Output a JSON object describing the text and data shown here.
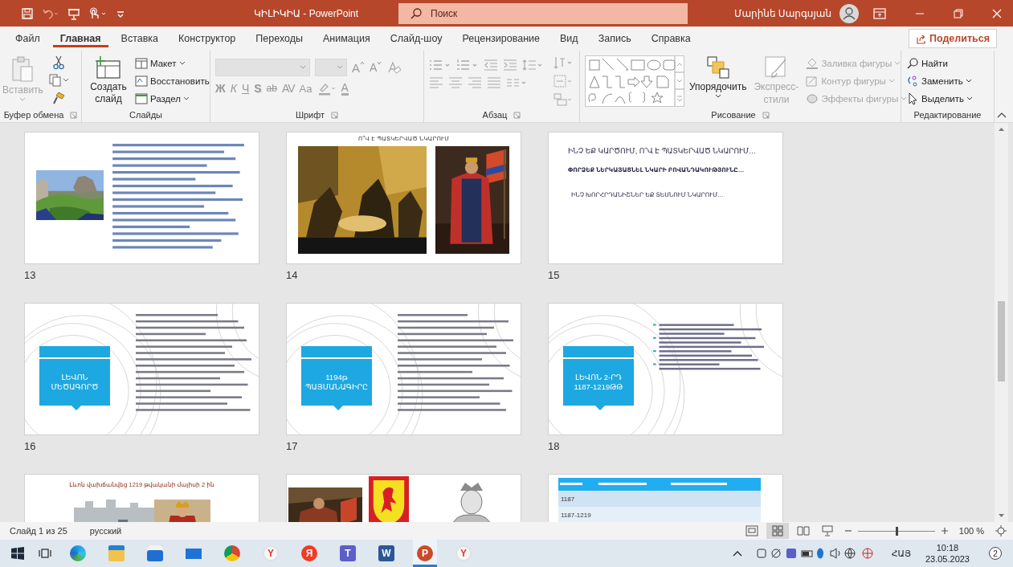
{
  "window": {
    "title": "ԿԻԼԻԿԻԱ  -  PowerPoint",
    "search_placeholder": "Поиск",
    "user": "Մարինե Սարգսյան"
  },
  "menu_tabs": [
    {
      "label": "Файл",
      "selected": false
    },
    {
      "label": "Главная",
      "selected": true
    },
    {
      "label": "Вставка",
      "selected": false
    },
    {
      "label": "Конструктор",
      "selected": false
    },
    {
      "label": "Переходы",
      "selected": false
    },
    {
      "label": "Анимация",
      "selected": false
    },
    {
      "label": "Слайд-шоу",
      "selected": false
    },
    {
      "label": "Рецензирование",
      "selected": false
    },
    {
      "label": "Вид",
      "selected": false
    },
    {
      "label": "Запись",
      "selected": false
    },
    {
      "label": "Справка",
      "selected": false
    }
  ],
  "share_button": "Поделиться",
  "ribbon": {
    "clipboard": {
      "label": "Буфер обмена",
      "paste": {
        "label": "Вставить",
        "disabled": true
      }
    },
    "slides": {
      "label": "Слайды",
      "new_slide": "Создать слайд",
      "items": [
        "Макет",
        "Восстановить",
        "Раздел"
      ]
    },
    "font": {
      "label": "Шрифт",
      "size_keys": [
        "A",
        "A"
      ],
      "format_keys": [
        "Ж",
        "К",
        "Ч",
        "S",
        "ab",
        "AV",
        "Aa"
      ],
      "color_key": "A"
    },
    "paragraph": {
      "label": "Абзац"
    },
    "drawing": {
      "label": "Рисование",
      "arrange": "Упорядочить",
      "quick_styles": {
        "label": "Экспресс-стили",
        "disabled": true
      },
      "items": [
        {
          "label": "Заливка фигуры",
          "disabled": true
        },
        {
          "label": "Контур фигуры",
          "disabled": true
        },
        {
          "label": "Эффекты фигуры",
          "disabled": true
        }
      ]
    },
    "editing": {
      "label": "Редактирование",
      "items": [
        "Найти",
        "Заменить",
        "Выделить"
      ]
    }
  },
  "slides": [
    {
      "kind": "text-image",
      "number": "13"
    },
    {
      "kind": "pictures",
      "number": "14",
      "title": "Ո՞Վ Է ՊԱՏԿԵՐՎԱԾ ՆԿԱՐՈՒՄ"
    },
    {
      "kind": "questions",
      "number": "15",
      "lines": [
        "ԻՆՉ ԵՔ ԿԱՐԾՈՒՄ, Ո՞Վ Է ՊԱՏԿԵՐՎԱԾ ՆԿԱՐՈՒՄ…",
        "ՓՈՐՁԵՔ ՆԵՐԿԱՅԱՑՆԵԼ ՆԿԱՐԻ ԲՈՎԱՆԴԱԿՈՒԹՅՈՒՆԸ…",
        "ԻՆՉ ԽՈՐՀՐԴԱՆԻՇՆԵՐ ԵՔ ՏԵՍՆՈՒՄ ՆԿԱՐՈՒՄ…"
      ]
    },
    {
      "kind": "callout",
      "number": "16",
      "title": "ԼԵՎՈՆ ՄԵԾԱԳՈՐԾ"
    },
    {
      "kind": "callout",
      "number": "17",
      "title": "1194թ ՊԱՅՄԱՆԱԳԻՐԸ"
    },
    {
      "kind": "callout",
      "number": "18",
      "title": "ԼԵՎՈՆ 2-ՐԴ 1187-1219ԹԹ"
    },
    {
      "kind": "titled-picture",
      "title": "Լևոն վախճանվեց 1219 թվականի մայիսի 2 ին"
    },
    {
      "kind": "pictures-row"
    },
    {
      "kind": "table",
      "rows": [
        "1187",
        "1187-1219"
      ]
    }
  ],
  "status_bar": {
    "slide": "Слайд 1 из 25",
    "language": "русский",
    "zoom": {
      "level": 0.5,
      "reading": "100 %"
    }
  },
  "taskbar": {
    "apps": [
      {
        "kind": "edge",
        "selected": false
      },
      {
        "kind": "explorer",
        "selected": false
      },
      {
        "kind": "store",
        "selected": false
      },
      {
        "kind": "mail",
        "selected": false
      },
      {
        "kind": "chrome",
        "selected": false
      },
      {
        "kind": "yandex",
        "glyph": "Y",
        "selected": false
      },
      {
        "kind": "yandex-alt",
        "glyph": "Я",
        "selected": false
      },
      {
        "kind": "teams",
        "glyph": "T",
        "selected": false
      },
      {
        "kind": "word",
        "glyph": "W",
        "selected": false
      },
      {
        "kind": "powerpoint",
        "glyph": "P",
        "selected": true
      },
      {
        "kind": "yandex",
        "glyph": "Y",
        "selected": false
      }
    ],
    "language": "ՀԱՅ",
    "time": "10:18",
    "date": "23.05.2023",
    "notifications": "2"
  }
}
